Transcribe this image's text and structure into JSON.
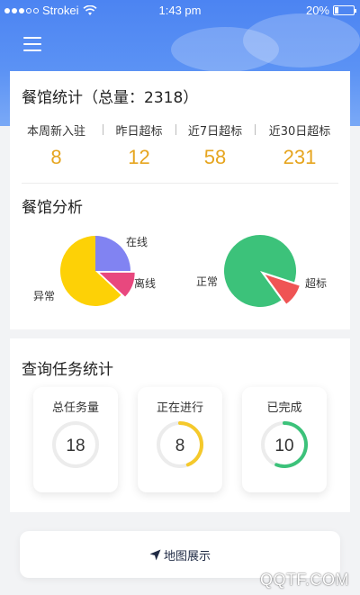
{
  "status_bar": {
    "carrier": "Strokei",
    "time": "1:43 pm",
    "battery": "20%",
    "battery_level": 0.2
  },
  "restaurant_stats": {
    "title": "餐馆统计（总量：2318）",
    "items": [
      {
        "label": "本周新入驻",
        "value": "8"
      },
      {
        "label": "昨日超标",
        "value": "12"
      },
      {
        "label": "近7日超标",
        "value": "58"
      },
      {
        "label": "近30日超标",
        "value": "231"
      }
    ]
  },
  "restaurant_analysis": {
    "title": "餐馆分析"
  },
  "chart_data": [
    {
      "type": "pie",
      "labels": [
        "在线",
        "离线",
        "异常"
      ],
      "values": [
        25,
        12,
        63
      ],
      "colors": [
        "#8183f2",
        "#e8487e",
        "#fdd106"
      ]
    },
    {
      "type": "pie",
      "labels": [
        "正常",
        "超标"
      ],
      "values": [
        90,
        10
      ],
      "colors": [
        "#3cc27a",
        "#ef5454"
      ]
    }
  ],
  "task_stats": {
    "title": "查询任务统计",
    "tasks": [
      {
        "label": "总任务量",
        "value": "18",
        "progress": 0,
        "color": "#e6e6e6"
      },
      {
        "label": "正在进行",
        "value": "8",
        "progress": 0.44,
        "color": "#f5c92b"
      },
      {
        "label": "已完成",
        "value": "10",
        "progress": 0.56,
        "color": "#3cc27a"
      }
    ]
  },
  "map_button": {
    "label": "地图展示",
    "icon": "navigation-arrow-icon"
  },
  "watermark": "QQTF.COM"
}
